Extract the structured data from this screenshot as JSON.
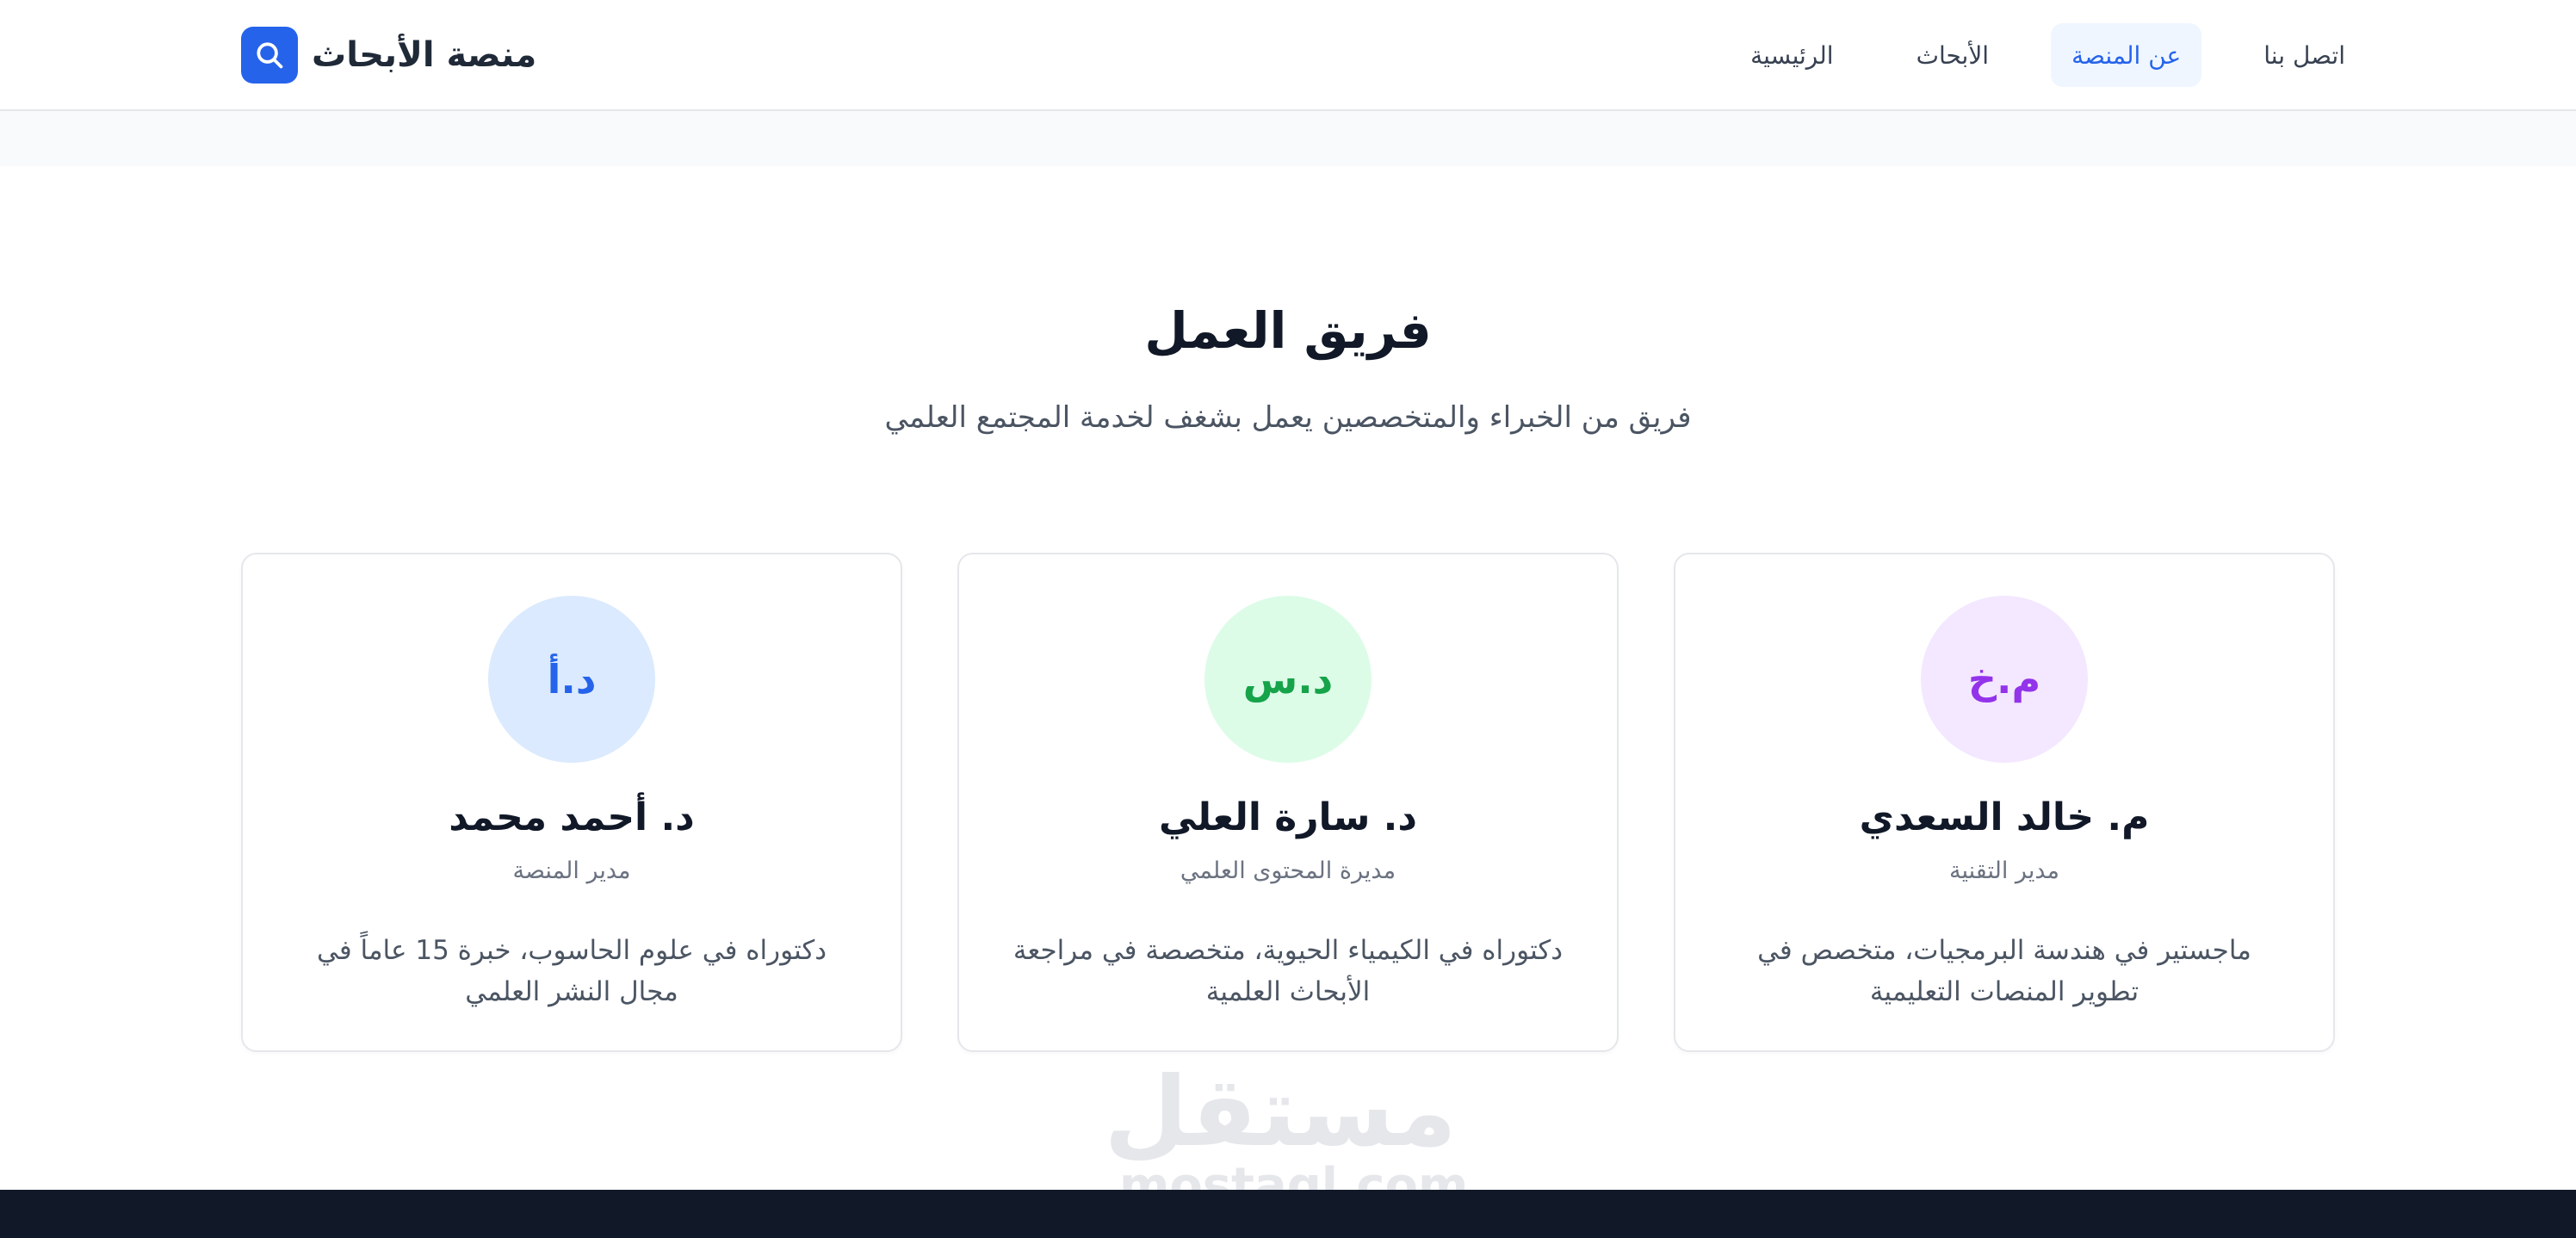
{
  "brand": {
    "name": "منصة الأبحاث",
    "icon": "search-icon",
    "color": "#2563eb"
  },
  "nav": {
    "items": [
      {
        "label": "اتصل بنا",
        "active": false
      },
      {
        "label": "عن المنصة",
        "active": true
      },
      {
        "label": "الأبحاث",
        "active": false
      },
      {
        "label": "الرئيسية",
        "active": false
      }
    ]
  },
  "team": {
    "title": "فريق العمل",
    "subtitle": "فريق من الخبراء والمتخصصين يعمل بشغف لخدمة المجتمع العلمي",
    "members": [
      {
        "initials": "م.خ",
        "name": "م. خالد السعدي",
        "role": "مدير التقنية",
        "description": "ماجستير في هندسة البرمجيات، متخصص في تطوير المنصات التعليمية",
        "avatar_bg": "#f3e8ff",
        "avatar_color": "#9333ea"
      },
      {
        "initials": "د.س",
        "name": "د. سارة العلي",
        "role": "مديرة المحتوى العلمي",
        "description": "دكتوراه في الكيمياء الحيوية، متخصصة في مراجعة الأبحاث العلمية",
        "avatar_bg": "#dcfce7",
        "avatar_color": "#16a34a"
      },
      {
        "initials": "د.أ",
        "name": "د. أحمد محمد",
        "role": "مدير المنصة",
        "description": "دكتوراه في علوم الحاسوب، خبرة 15 عاماً في مجال النشر العلمي",
        "avatar_bg": "#dbeafe",
        "avatar_color": "#2563eb"
      }
    ]
  },
  "watermark": {
    "main": "مستقل",
    "sub": "mostaql.com"
  }
}
